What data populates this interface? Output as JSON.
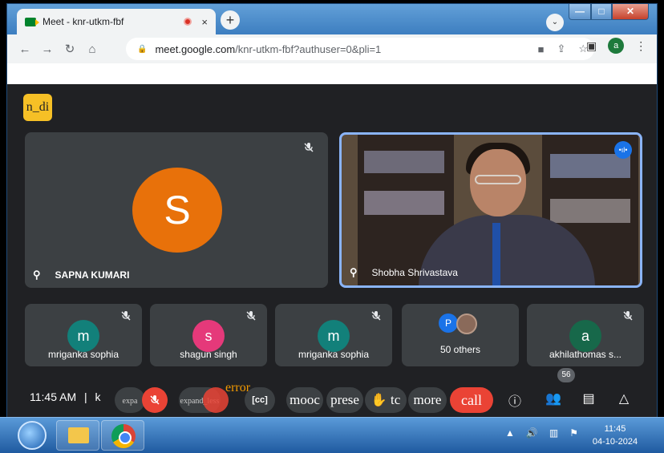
{
  "browser": {
    "tab_title": "Meet - knr-utkm-fbf",
    "tab_close": "×",
    "new_tab": "+",
    "tab_search": "⌄",
    "url_domain": "meet.google.com",
    "url_path": "/knr-utkm-fbf?authuser=0&pli=1",
    "profile_initial": "a",
    "window_buttons": {
      "minimize": "—",
      "maximize": "□",
      "close": "✕"
    },
    "nav": {
      "back": "←",
      "forward": "→",
      "reload": "↻",
      "home": "⌂"
    }
  },
  "meet": {
    "badge_text": "n_di",
    "main_tiles": [
      {
        "name": "SAPNA KUMARI",
        "initial": "S",
        "avatar_color": "#e8710a",
        "muted": true
      },
      {
        "name": "Shobha Shrivastava",
        "speaking": true
      }
    ],
    "small_tiles": [
      {
        "name": "mriganka sophia",
        "initial": "m",
        "avatar_color": "#12807a"
      },
      {
        "name": "shagun singh",
        "initial": "s",
        "avatar_color": "#e5397a"
      },
      {
        "name": "mriganka sophia",
        "initial": "m",
        "avatar_color": "#12807a"
      },
      {
        "name": "50 others",
        "initial": "P",
        "avatar_color": "#1a73e8"
      },
      {
        "name": "akhilathomas s...",
        "initial": "a",
        "avatar_color": "#17684a"
      }
    ],
    "controls": {
      "time": "11:45 AM",
      "separator": "|",
      "meeting_code_fragment": "k",
      "expand_mic_label": "expa",
      "expand_cam_label": "expand_less",
      "error_text": "error",
      "mood_label": "mooc",
      "present_label": "prese",
      "raise_hand_label": "tc",
      "more_label": "more",
      "call_label": "call",
      "participant_count": "56"
    }
  },
  "taskbar": {
    "time": "11:45",
    "date": "04-10-2024"
  }
}
